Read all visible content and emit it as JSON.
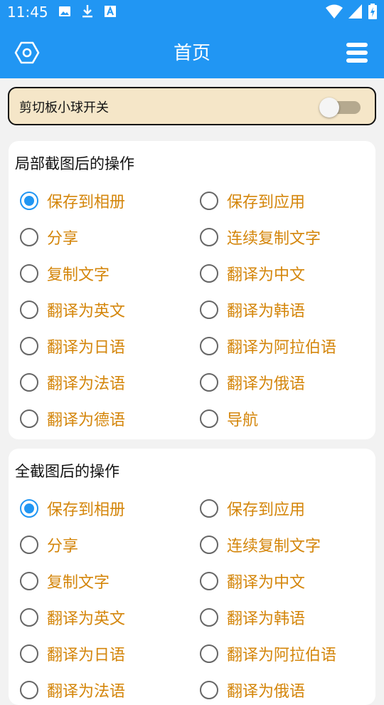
{
  "status_bar": {
    "time": "11:45",
    "left_icons": [
      "image-icon",
      "download-icon",
      "font-a-icon"
    ],
    "right_icons": [
      "wifi-icon",
      "signal-icon",
      "battery-icon"
    ]
  },
  "app_bar": {
    "title": "首页",
    "left_icon": "settings-hexagon-icon",
    "right_icon": "menu-icon"
  },
  "clipboard_toggle": {
    "label": "剪切板小球开关",
    "enabled": false
  },
  "sections": [
    {
      "title": "局部截图后的操作",
      "selected": "保存到相册",
      "options": [
        "保存到相册",
        "保存到应用",
        "分享",
        "连续复制文字",
        "复制文字",
        "翻译为中文",
        "翻译为英文",
        "翻译为韩语",
        "翻译为日语",
        "翻译为阿拉伯语",
        "翻译为法语",
        "翻译为俄语",
        "翻译为德语",
        "导航"
      ]
    },
    {
      "title": "全截图后的操作",
      "selected": "保存到相册",
      "options": [
        "保存到相册",
        "保存到应用",
        "分享",
        "连续复制文字",
        "复制文字",
        "翻译为中文",
        "翻译为英文",
        "翻译为韩语",
        "翻译为日语",
        "翻译为阿拉伯语",
        "翻译为法语",
        "翻译为俄语"
      ]
    }
  ],
  "colors": {
    "primary": "#2196f3",
    "option_text": "#d4860b",
    "toggle_card_bg": "#f5e6c8"
  }
}
